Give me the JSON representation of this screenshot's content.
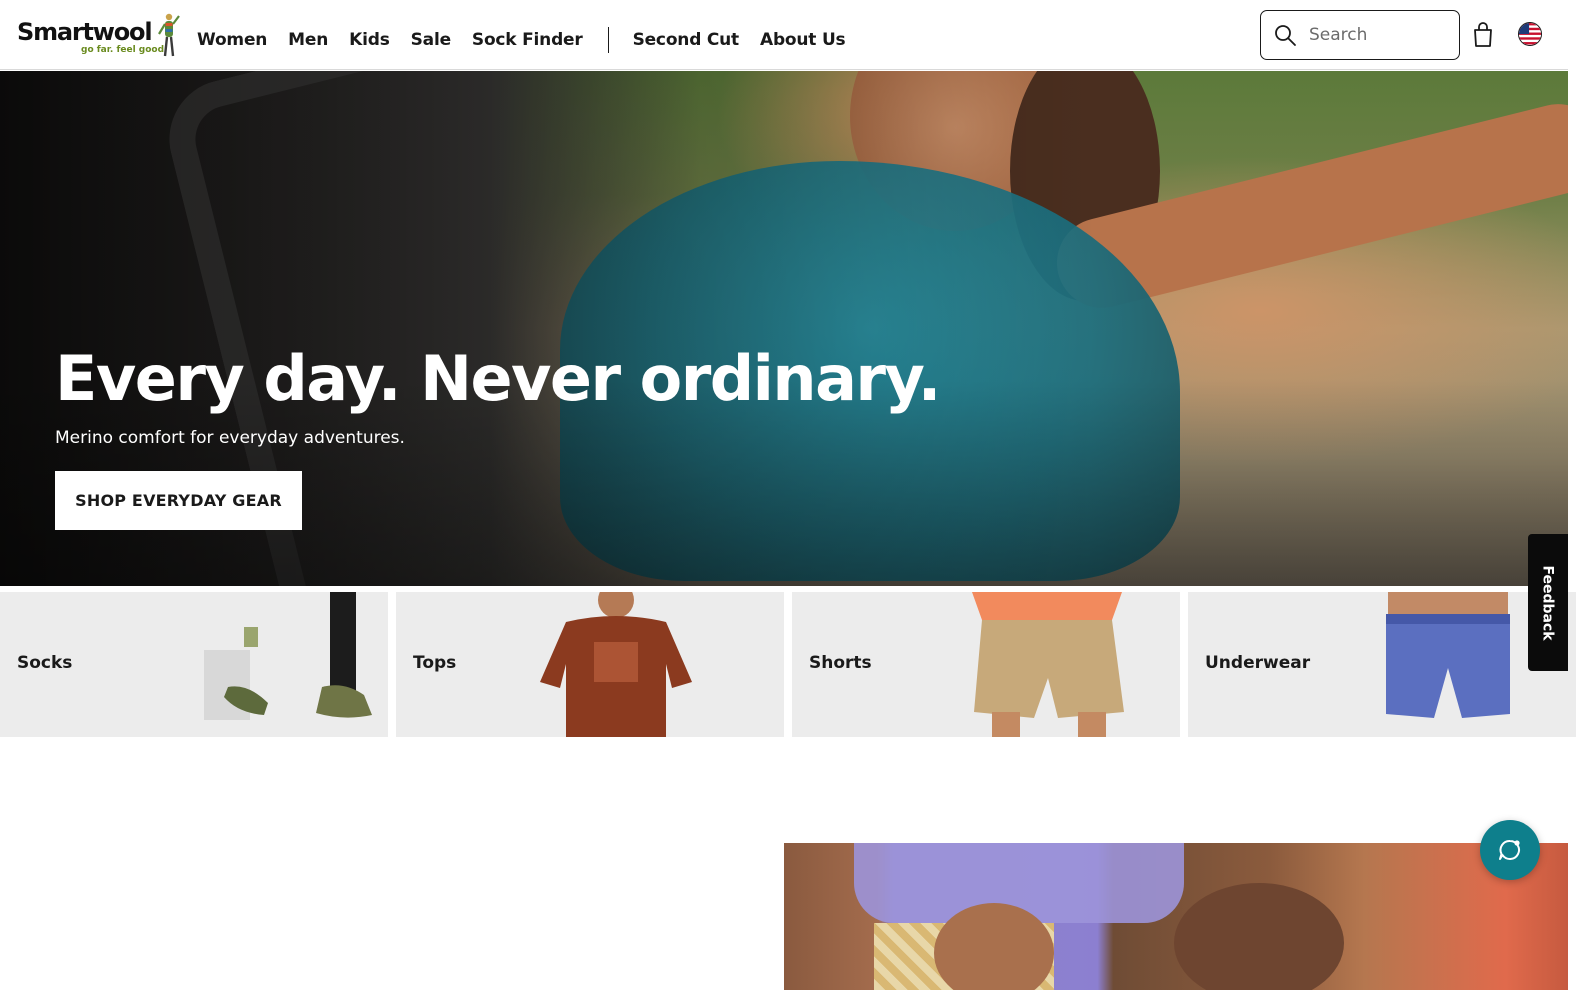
{
  "brand": {
    "name": "Smartwool",
    "tagline": "go far. feel good."
  },
  "nav": {
    "items": [
      {
        "label": "Women"
      },
      {
        "label": "Men"
      },
      {
        "label": "Kids"
      },
      {
        "label": "Sale"
      },
      {
        "label": "Sock Finder"
      }
    ],
    "secondary_items": [
      {
        "label": "Second Cut"
      },
      {
        "label": "About Us"
      }
    ]
  },
  "search": {
    "placeholder": "Search",
    "icon": "search-icon"
  },
  "header_icons": {
    "cart": "shopping-bag-icon",
    "locale": "us-flag-icon"
  },
  "hero": {
    "title": "Every day. Never ordinary.",
    "subtitle": "Merino comfort for everyday adventures.",
    "cta_label": "SHOP EVERYDAY GEAR"
  },
  "categories": [
    {
      "label": "Socks"
    },
    {
      "label": "Tops"
    },
    {
      "label": "Shorts"
    },
    {
      "label": "Underwear"
    }
  ],
  "feedback": {
    "label": "Feedback"
  },
  "chat": {
    "icon": "chat-bubble-icon"
  },
  "colors": {
    "accent_teal": "#0e7f8c",
    "text": "#1a1a1a",
    "tile_bg": "#ececec",
    "brand_green": "#6a8b1f"
  }
}
